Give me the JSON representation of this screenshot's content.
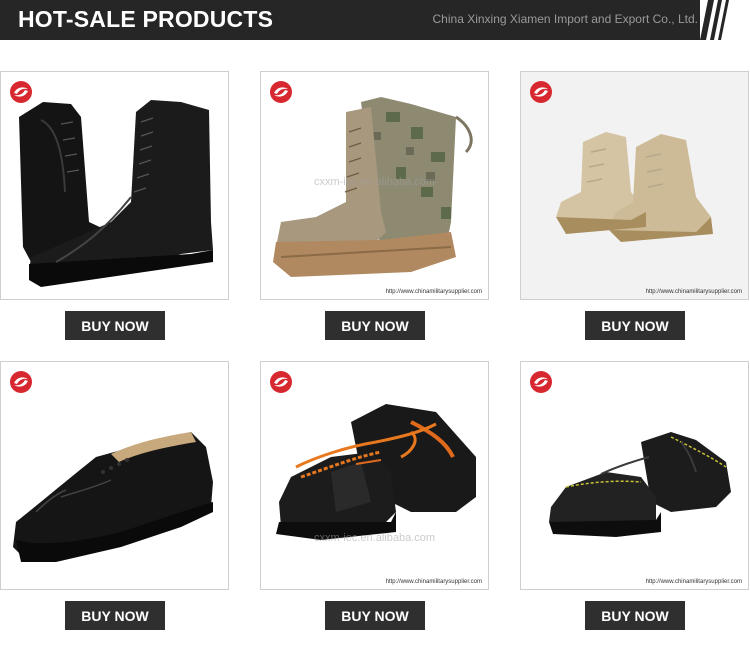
{
  "header": {
    "title": "HOT-SALE PRODUCTS",
    "company": "China Xinxing Xiamen Import and Export Co., Ltd."
  },
  "products": [
    {
      "name": "Black leather combat boots",
      "button": "BUY NOW",
      "watermark": "",
      "url": ""
    },
    {
      "name": "Desert camouflage jungle boots",
      "button": "BUY NOW",
      "watermark": "cxxm-iec.en.alibaba.com",
      "url": "http://www.chinamilitarysupplier.com"
    },
    {
      "name": "Tan desert boots",
      "button": "BUY NOW",
      "watermark": "",
      "url": "http://www.chinamilitarysupplier.com"
    },
    {
      "name": "Black leather oxford officer shoes",
      "button": "BUY NOW",
      "watermark": "",
      "url": ""
    },
    {
      "name": "Black safety shoes with orange laces",
      "button": "BUY NOW",
      "watermark": "cxxm-iec.en.alibaba.com",
      "url": "http://www.chinamilitarysupplier.com"
    },
    {
      "name": "Black safety shoes with yellow stitching",
      "button": "BUY NOW",
      "watermark": "",
      "url": "http://www.chinamilitarysupplier.com"
    }
  ],
  "colors": {
    "header_bg": "#262626",
    "button_bg": "#2f2f2f",
    "logo_red": "#d7282f"
  }
}
